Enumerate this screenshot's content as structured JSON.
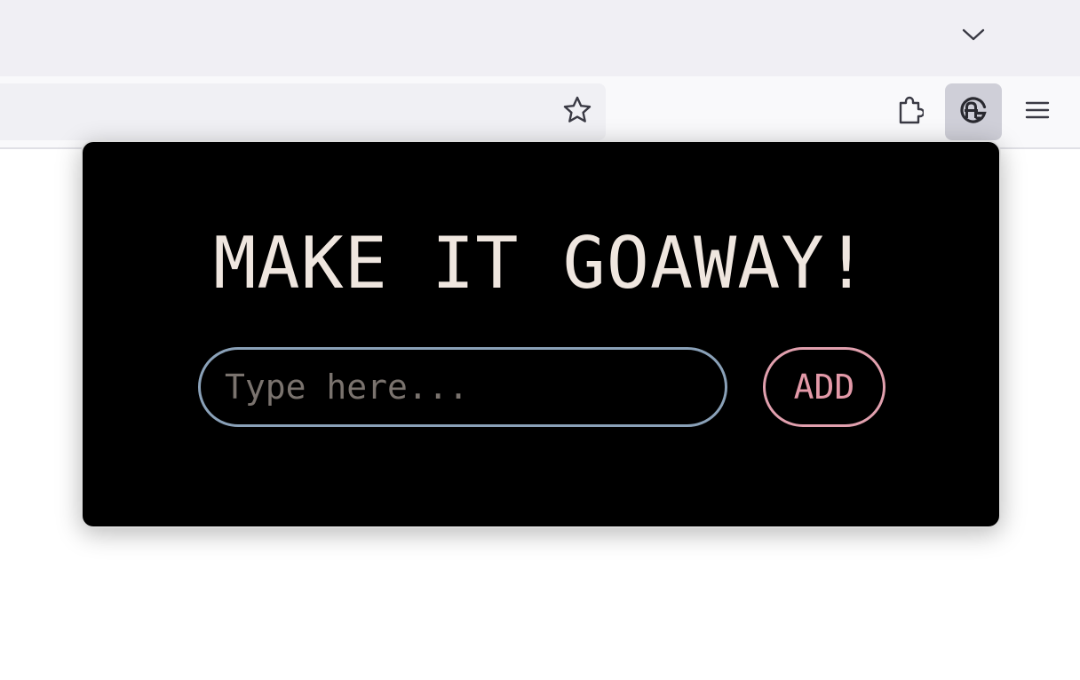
{
  "browser": {
    "tab_list_icon": "chevron-down-icon",
    "bookmark_icon": "star-icon",
    "extensions_icon": "puzzle-icon",
    "goaway_extension_icon": "goaway-logo-icon",
    "menu_icon": "hamburger-menu-icon"
  },
  "popup": {
    "title": "MAKE IT GOAWAY!",
    "input": {
      "value": "",
      "placeholder": "Type here..."
    },
    "add_label": "ADD"
  },
  "colors": {
    "popup_background": "#000000",
    "title_text": "#efe6df",
    "input_border": "#8aa1b8",
    "add_button_accent": "#e399a8",
    "active_toolbar_button": "#cfcfd8"
  }
}
